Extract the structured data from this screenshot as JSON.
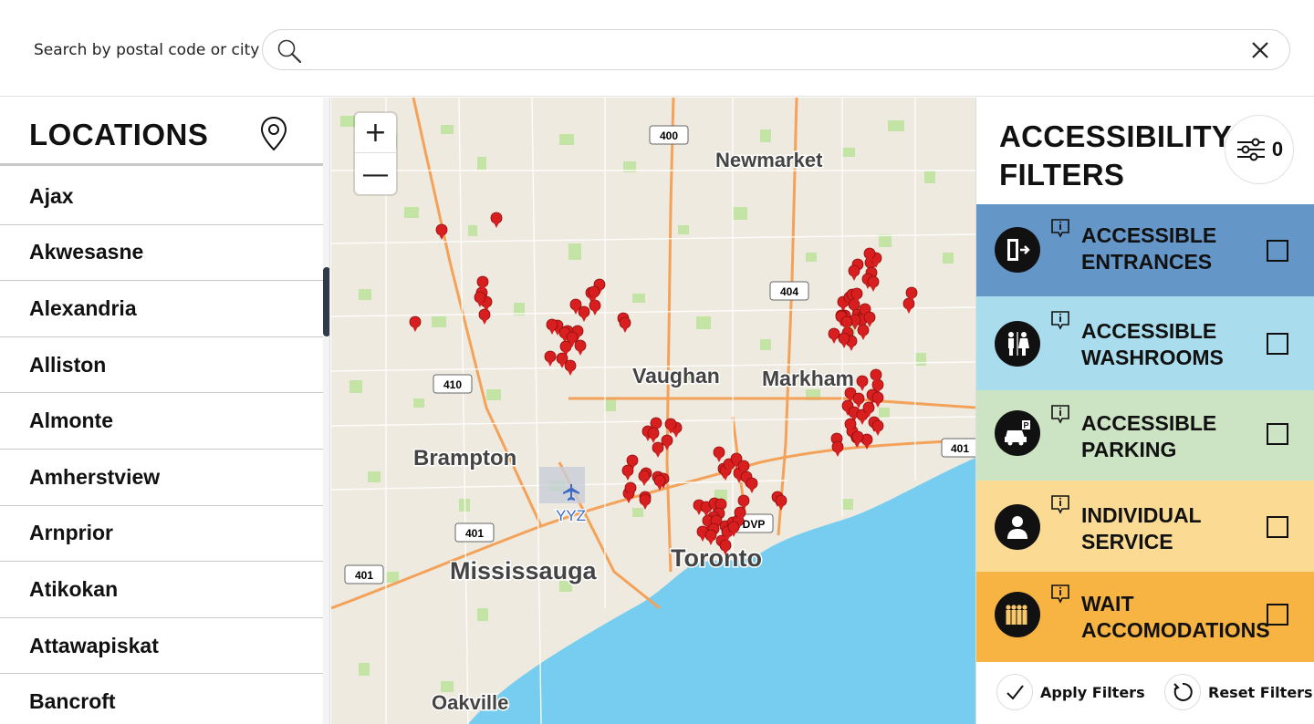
{
  "search": {
    "label": "Search by postal code or city",
    "placeholder": "",
    "value": ""
  },
  "locations": {
    "title": "LOCATIONS",
    "items": [
      "Ajax",
      "Akwesasne",
      "Alexandria",
      "Alliston",
      "Almonte",
      "Amherstview",
      "Arnprior",
      "Atikokan",
      "Attawapiskat",
      "Bancroft"
    ]
  },
  "map": {
    "zoom_in": "+",
    "zoom_out": "—",
    "cities": [
      {
        "name": "Newmarket"
      },
      {
        "name": "Vaughan"
      },
      {
        "name": "Markham"
      },
      {
        "name": "Brampton"
      },
      {
        "name": "Mississauga"
      },
      {
        "name": "Toronto"
      },
      {
        "name": "Oakville"
      }
    ],
    "highway_shields": [
      "400",
      "404",
      "410",
      "401",
      "401",
      "401",
      "DVP"
    ],
    "airport_code": "YYZ",
    "colors": {
      "land": "#eeeadf",
      "water": "#76cdf0",
      "highway": "#f4a259",
      "park": "#c4e4a6",
      "marker": "#d81e1e"
    }
  },
  "filters": {
    "title_line1": "ACCESSIBILITY",
    "title_line2": "FILTERS",
    "active_count": "0",
    "items": [
      {
        "line1": "ACCESSIBLE",
        "line2": "ENTRANCES",
        "color": "#6596c8",
        "icon": "entrance-icon",
        "checked": false
      },
      {
        "line1": "ACCESSIBLE",
        "line2": "WASHROOMS",
        "color": "#a9dcec",
        "icon": "washroom-icon",
        "checked": false
      },
      {
        "line1": "ACCESSIBLE",
        "line2": "PARKING",
        "color": "#cce3c4",
        "icon": "parking-icon",
        "checked": false
      },
      {
        "line1": "INDIVIDUAL",
        "line2": "SERVICE",
        "color": "#fbdb94",
        "icon": "person-icon",
        "checked": false
      },
      {
        "line1": "WAIT",
        "line2": "ACCOMODATIONS",
        "color": "#f8b443",
        "icon": "queue-icon",
        "checked": false
      }
    ],
    "apply_label": "Apply Filters",
    "reset_label": "Reset Filters"
  }
}
